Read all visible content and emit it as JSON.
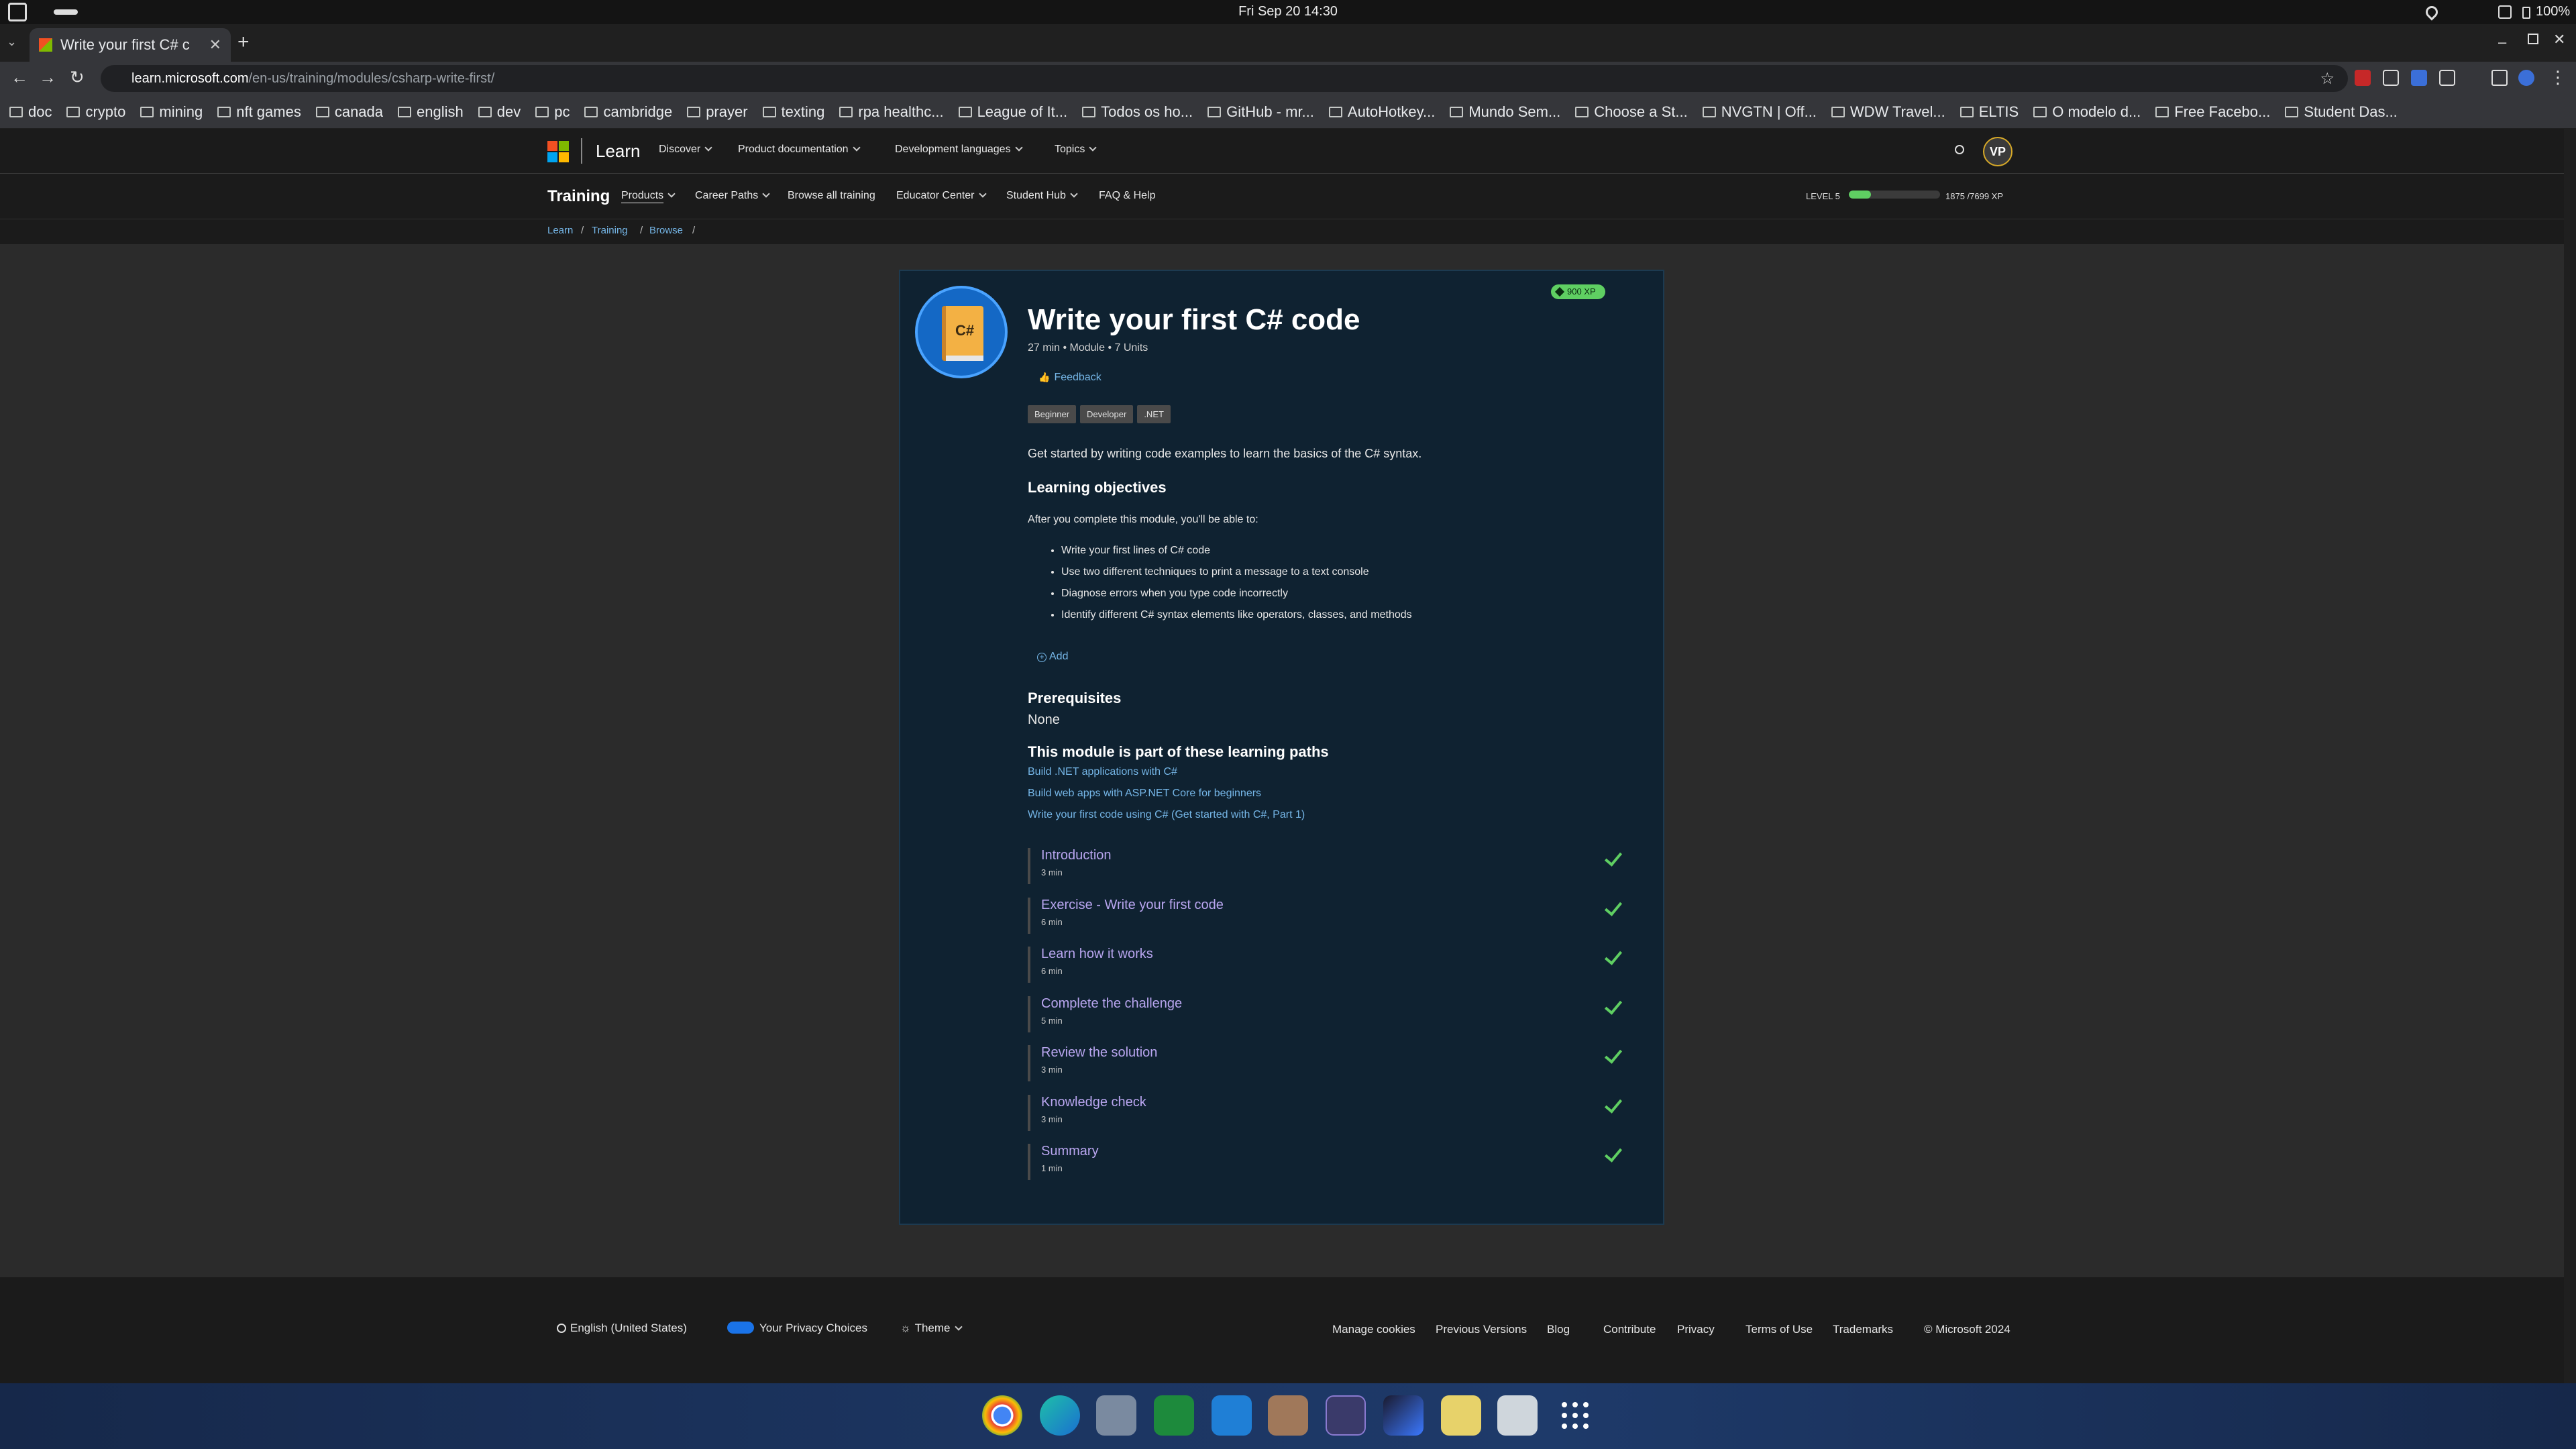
{
  "os_bar": {
    "datetime": "Fri Sep 20  14:30",
    "battery": "100%"
  },
  "browser": {
    "tab_title": "Write your first C# c",
    "url_host": "learn.microsoft.com",
    "url_path": "/en-us/training/modules/csharp-write-first/",
    "bookmarks": [
      "doc",
      "crypto",
      "mining",
      "nft games",
      "canada",
      "english",
      "dev",
      "pc",
      "cambridge",
      "prayer",
      "texting",
      "rpa healthc...",
      "League of It...",
      "Todos os ho...",
      "GitHub - mr...",
      "AutoHotkey...",
      "Mundo Sem...",
      "Choose a St...",
      "NVGTN | Off...",
      "WDW Travel...",
      "ELTIS",
      "O modelo d...",
      "Free Facebo...",
      "Student Das..."
    ]
  },
  "header": {
    "brand": "Learn",
    "menu": [
      "Discover",
      "Product documentation",
      "Development languages",
      "Topics"
    ],
    "avatar": "VP"
  },
  "training_nav": {
    "title": "Training",
    "items": [
      "Products",
      "Career Paths",
      "Browse all training",
      "Educator Center",
      "Student Hub",
      "FAQ & Help"
    ],
    "level_label": "LEVEL 5",
    "level_progress": 0.24,
    "xp_text": "1875 /7699 XP"
  },
  "breadcrumb": [
    "Learn",
    "Training",
    "Browse"
  ],
  "module": {
    "xp_badge": "900 XP",
    "icon_text": "C#",
    "title": "Write your first C# code",
    "meta": "27 min • Module • 7 Units",
    "feedback": "Feedback",
    "tags": [
      "Beginner",
      "Developer",
      ".NET"
    ],
    "summary": "Get started by writing code examples to learn the basics of the C# syntax.",
    "objectives_heading": "Learning objectives",
    "objectives_intro": "After you complete this module, you'll be able to:",
    "objectives": [
      "Write your first lines of C# code",
      "Use two different techniques to print a message to a text console",
      "Diagnose errors when you type code incorrectly",
      "Identify different C# syntax elements like operators, classes, and methods"
    ],
    "add_label": "Add",
    "prereq_heading": "Prerequisites",
    "prereq_value": "None",
    "paths_heading": "This module is part of these learning paths",
    "paths": [
      "Build .NET applications with C#",
      "Build web apps with ASP.NET Core for beginners",
      "Write your first code using C# (Get started with C#, Part 1)"
    ],
    "units": [
      {
        "title": "Introduction",
        "duration": "3 min"
      },
      {
        "title": "Exercise - Write your first code",
        "duration": "6 min"
      },
      {
        "title": "Learn how it works",
        "duration": "6 min"
      },
      {
        "title": "Complete the challenge",
        "duration": "5 min"
      },
      {
        "title": "Review the solution",
        "duration": "3 min"
      },
      {
        "title": "Knowledge check",
        "duration": "3 min"
      },
      {
        "title": "Summary",
        "duration": "1 min"
      }
    ]
  },
  "footer": {
    "language": "English (United States)",
    "privacy_choices": "Your Privacy Choices",
    "theme": "Theme",
    "links": [
      "Manage cookies",
      "Previous Versions",
      "Blog",
      "Contribute",
      "Privacy",
      "Terms of Use",
      "Trademarks",
      "© Microsoft 2024"
    ]
  },
  "colors": {
    "accent_link": "#75b6e7",
    "unit_link": "#b9a6f0",
    "check": "#5fcf62",
    "card_bg": "#0f2231"
  }
}
